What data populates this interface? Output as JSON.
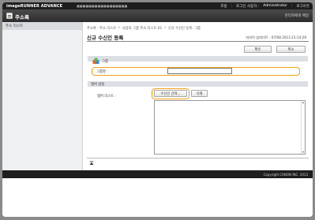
{
  "topbar": {
    "product": "imageRUNNER ADVANCE",
    "host": "■■■■■■■■■■■■■■■■■",
    "links": {
      "portal": "포털",
      "login_user": "로그인 사용자 :",
      "username": "Administrator",
      "logout": "로그아웃"
    }
  },
  "titlebar": {
    "icon": "address-book-icon",
    "title": "주소록",
    "back_link": "관리자에게 메일"
  },
  "sidebar": {
    "items": [
      {
        "label": "주소 리스트"
      }
    ]
  },
  "main": {
    "breadcrumb": [
      "주소록 : 주소 리스트",
      "사용자 그룹 주소 리스트 01",
      "신규 수신인 등록: 그룹"
    ],
    "breadcrumb_sep": ">",
    "page_title": "신규 수신인 등록",
    "last_updated": "마지막 업데이트 : 07/08 2013 21:14:29",
    "buttons": {
      "ok": "확인",
      "cancel": "취소"
    },
    "group_section": {
      "header": "그룹",
      "icon": "group-icon",
      "name_label": "그룹명 :",
      "name_value": ""
    },
    "member_section": {
      "header": "멤버 설정",
      "list_label": "멤버 리스트 :",
      "select_button": "수신인 선택...",
      "delete_button": "삭제",
      "members": []
    },
    "top_icon": "page-top-icon"
  },
  "footer": {
    "copyright": "Copyright CANON INC. 2013"
  },
  "colors": {
    "highlight": "#f0a21a",
    "header_dark": "#1e1e1e"
  }
}
